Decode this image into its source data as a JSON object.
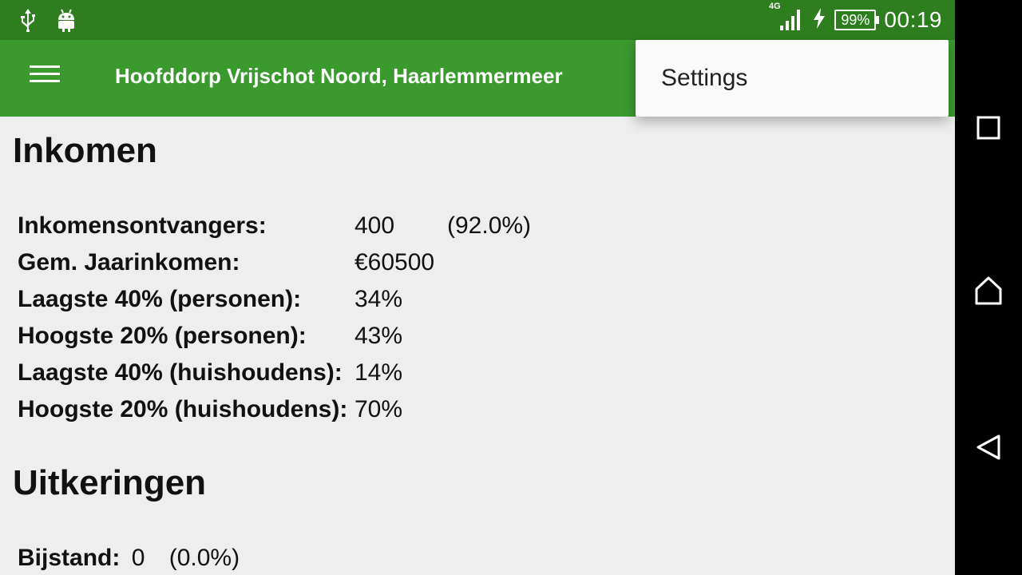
{
  "status_bar": {
    "left_icons": [
      "usb-icon",
      "android-debug-icon"
    ],
    "network": "4G",
    "battery": "99%",
    "time": "00:19"
  },
  "app_bar": {
    "title": "Hoofddorp Vrijschot Noord, Haarlemmermeer",
    "menu_icon": "hamburger-menu-icon"
  },
  "overflow_menu": {
    "items": [
      {
        "label": "Settings"
      }
    ]
  },
  "inkomen": {
    "heading": "Inkomen",
    "rows": [
      {
        "label": "Inkomensontvangers:",
        "value": "400",
        "percent": "(92.0%)"
      },
      {
        "label": "Gem. Jaarinkomen:",
        "value": "€60500"
      },
      {
        "label": "Laagste 40% (personen):",
        "value": "34%"
      },
      {
        "label": "Hoogste 20% (personen):",
        "value": "43%"
      },
      {
        "label": "Laagste 40% (huishoudens):",
        "value": "14%"
      },
      {
        "label": "Hoogste 20% (huishoudens):",
        "value": "70%"
      }
    ]
  },
  "uitkeringen": {
    "heading": "Uitkeringen",
    "rows": [
      {
        "label": "Bijstand:",
        "value": "0",
        "percent": "(0.0%)"
      }
    ]
  },
  "nav_bar": {
    "buttons": [
      "recents-icon",
      "home-icon",
      "back-icon"
    ]
  }
}
